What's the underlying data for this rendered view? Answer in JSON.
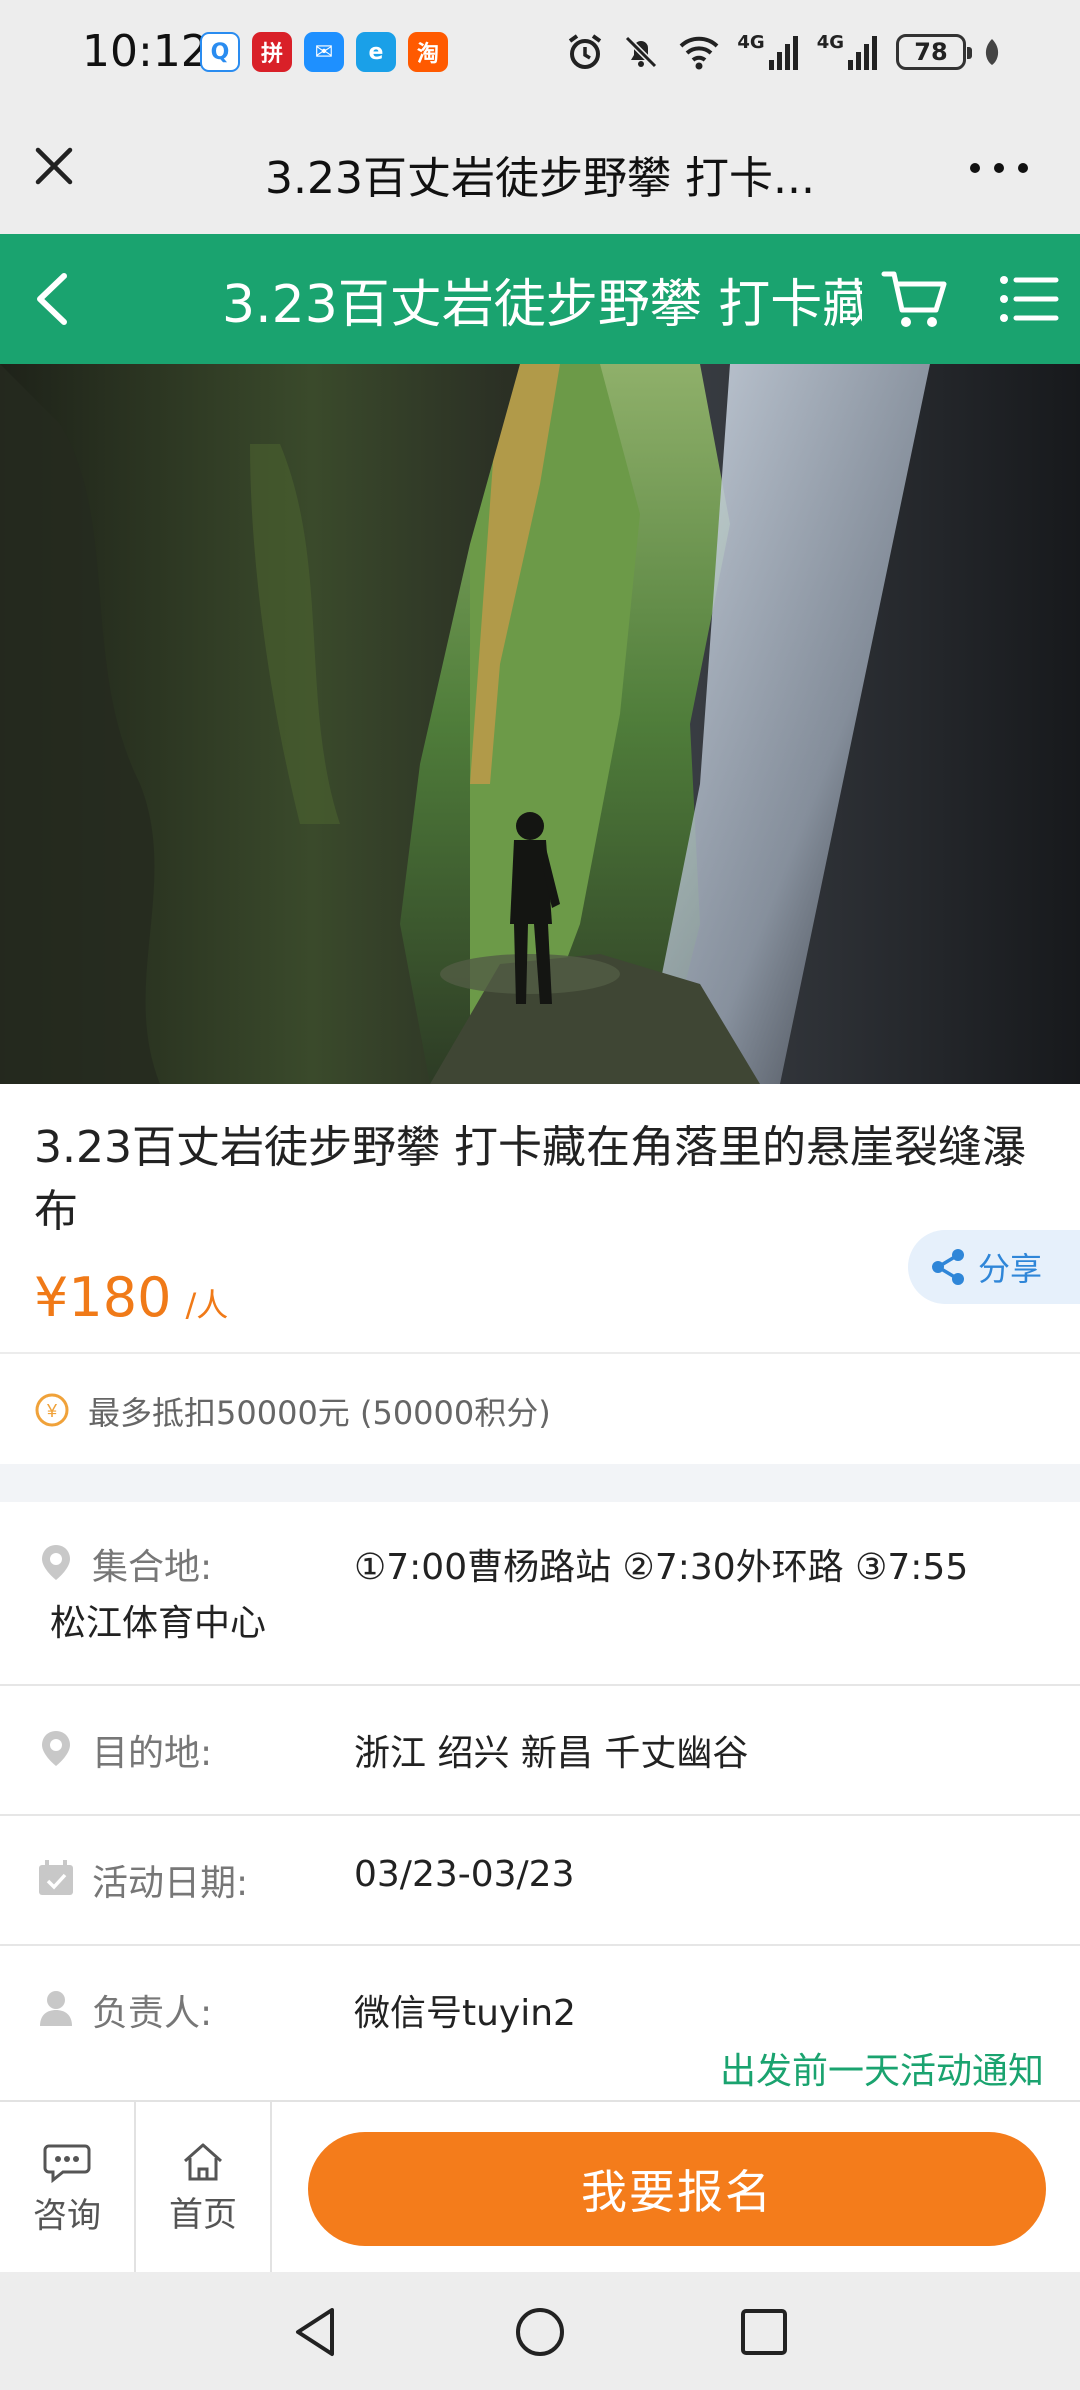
{
  "status_bar": {
    "time": "10:12",
    "app_icons": [
      {
        "name": "qq-browser-icon",
        "glyph": "Q"
      },
      {
        "name": "pinduoduo-icon",
        "glyph": "拼"
      },
      {
        "name": "message-icon",
        "glyph": "✉"
      },
      {
        "name": "e-app-icon",
        "glyph": "e"
      },
      {
        "name": "taobao-icon",
        "glyph": "淘"
      }
    ],
    "network_1": "4G",
    "network_2": "4G",
    "battery": "78"
  },
  "web_header": {
    "title": "3.23百丈岩徒步野攀 打卡..."
  },
  "nav": {
    "title": "3.23百丈岩徒步野攀 打卡藏"
  },
  "product": {
    "title": "3.23百丈岩徒步野攀 打卡藏在角落里的悬崖裂缝瀑布",
    "price": "¥180",
    "price_unit": "/人",
    "share_label": "分享",
    "points_text": "最多抵扣50000元 (50000积分)"
  },
  "details": {
    "meeting": {
      "label": "集合地:",
      "value_line1": "①7:00曹杨路站 ②7:30外环路 ③7:55",
      "value_line2": "松江体育中心"
    },
    "destination": {
      "label": "目的地:",
      "value": "浙江 绍兴 新昌 千丈幽谷"
    },
    "date": {
      "label": "活动日期:",
      "value": "03/23-03/23"
    },
    "leader": {
      "label": "负责人:",
      "value": "微信号tuyin2",
      "notice": "出发前一天活动通知"
    }
  },
  "bottom_bar": {
    "consult_label": "咨询",
    "home_label": "首页",
    "signup_label": "我要报名"
  },
  "colors": {
    "brand_green": "#1aa36f",
    "accent_orange": "#f47c1b",
    "share_blue": "#2f86d8"
  }
}
